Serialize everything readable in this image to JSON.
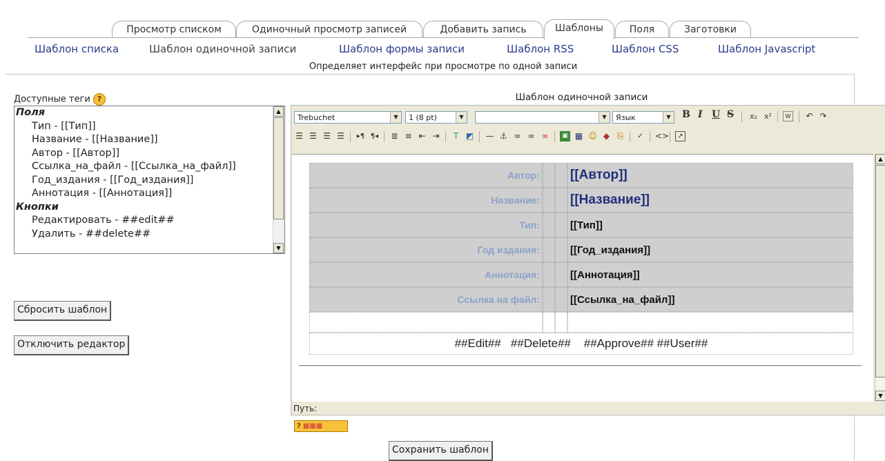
{
  "tabs": [
    {
      "label": "Просмотр списком"
    },
    {
      "label": "Одиночный просмотр записей"
    },
    {
      "label": "Добавить запись"
    },
    {
      "label": "Шаблоны"
    },
    {
      "label": "Поля"
    },
    {
      "label": "Заготовки"
    }
  ],
  "subtabs": [
    {
      "label": "Шаблон списка"
    },
    {
      "label": "Шаблон одиночной записи"
    },
    {
      "label": "Шаблон формы записи"
    },
    {
      "label": "Шаблон RSS"
    },
    {
      "label": "Шаблон CSS"
    },
    {
      "label": "Шаблон Javascript"
    }
  ],
  "description": "Определяет интерфейс при просмотре по одной записи",
  "tags": {
    "label": "Доступные теги",
    "help_glyph": "?",
    "groups": [
      {
        "name": "Поля",
        "items": [
          "Тип - [[Тип]]",
          "Название - [[Название]]",
          "Автор - [[Автор]]",
          "Ссылка_на_файл - [[Ссылка_на_файл]]",
          "Год_издания - [[Год_издания]]",
          "Аннотация - [[Аннотация]]"
        ]
      },
      {
        "name": "Кнопки",
        "items": [
          "Редактировать - ##edit##",
          "Удалить - ##delete##"
        ]
      }
    ]
  },
  "buttons": {
    "reset": "Сбросить шаблон",
    "disable_editor": "Отключить редактор",
    "save": "Сохранить шаблон"
  },
  "editor": {
    "title": "Шаблон одиночной записи",
    "font": "Trebuchet",
    "size": "1 (8 pt)",
    "style": "",
    "language": "Язык",
    "rows": [
      {
        "label": "Автор:",
        "value": "[[Автор]]"
      },
      {
        "label": "Название:",
        "value": "[[Название]]"
      },
      {
        "label": "Тип:",
        "value": "[[Тип]]"
      },
      {
        "label": "Год издания:",
        "value": "[[Год_издания]]"
      },
      {
        "label": "Аннотация:",
        "value": "[[Аннотация]]"
      },
      {
        "label": "Ссылка на файл:",
        "value": "[[Ссылка_на_файл]]"
      }
    ],
    "footer": "##Edit##   ##Delete##    ##Approve## ##User##",
    "path_label": "Путь:"
  },
  "colors": {
    "link": "#2a3a8c",
    "label": "#8aa2c8",
    "cell": "#cfcfcf",
    "toolbar": "#ece9d8"
  }
}
